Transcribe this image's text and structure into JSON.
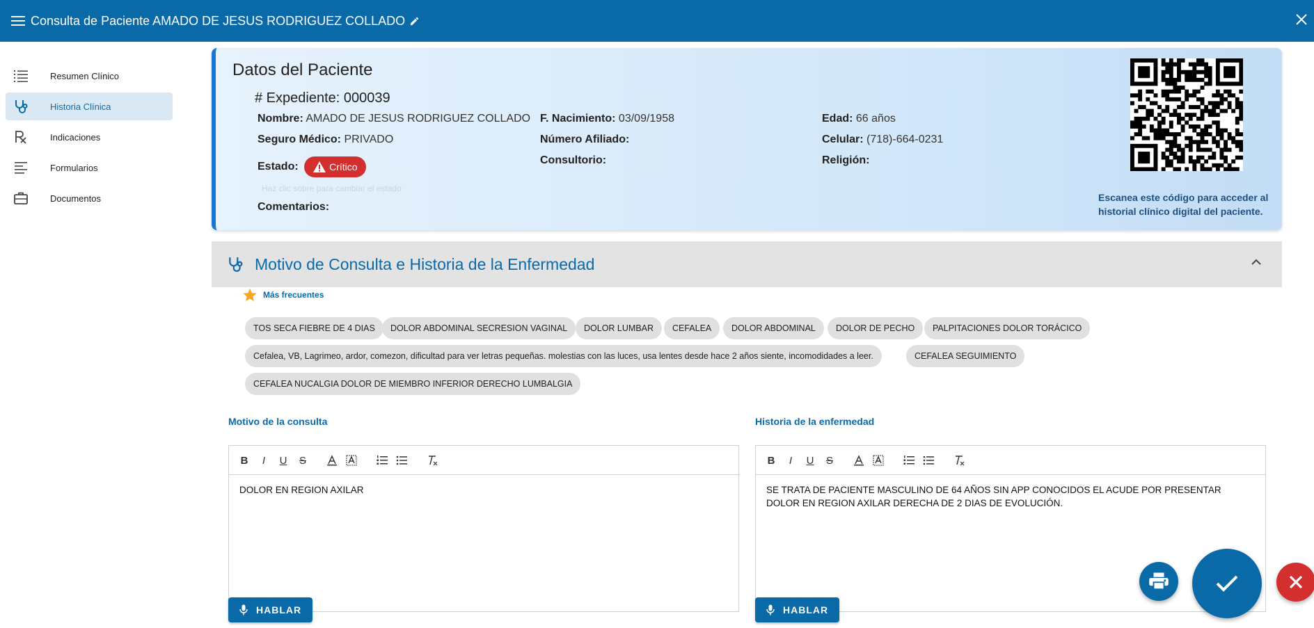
{
  "appbar": {
    "title": "Consulta de Paciente AMADO DE JESUS RODRIGUEZ COLLADO",
    "menu_icon": "menu-icon",
    "edit_icon": "pencil-icon",
    "close_icon": "close-icon",
    "color": "#0a6aa8"
  },
  "sidebar": {
    "items": [
      {
        "label": "Resumen Clínico",
        "icon": "list-icon",
        "active": false
      },
      {
        "label": "Historia Clínica",
        "icon": "stethoscope-icon",
        "active": true
      },
      {
        "label": "Indicaciones",
        "icon": "prescription-icon",
        "active": false
      },
      {
        "label": "Formularios",
        "icon": "lines-icon",
        "active": false
      },
      {
        "label": "Documentos",
        "icon": "briefcase-icon",
        "active": false
      }
    ]
  },
  "patient": {
    "card_title": "Datos del Paciente",
    "expediente": "# Expediente: 000039",
    "nombre_label": "Nombre:",
    "nombre": "AMADO DE JESUS RODRIGUEZ COLLADO",
    "nacimiento_label": "F. Nacimiento:",
    "nacimiento": "03/09/1958",
    "edad_label": "Edad:",
    "edad": "66 años",
    "seguro_label": "Seguro Médico:",
    "seguro": "PRIVADO",
    "afiliado_label": "Número Afiliado:",
    "afiliado": "",
    "celular_label": "Celular:",
    "celular": "(718)-664-0231",
    "estado_label": "Estado:",
    "estado": "Crítico",
    "estado_color": "#d32f2f",
    "consultorio_label": "Consultorio:",
    "consultorio": "",
    "religion_label": "Religión:",
    "religion": "",
    "faint_hint": "Haz clic sobre para cambiar el estado",
    "comentarios_label": "Comentarios:",
    "comentarios": "",
    "qr_caption": "Escanea este código para acceder al historial clínico digital del paciente."
  },
  "section": {
    "title": "Motivo de Consulta e Historia de la Enfermedad",
    "icon": "stethoscope-icon",
    "chevron": "chevron-up-icon",
    "frequent_label": "Más frecuentes",
    "chips": [
      "TOS SECA FIEBRE DE 4 DIAS",
      "DOLOR ABDOMINAL SECRESION VAGINAL",
      "DOLOR LUMBAR",
      "CEFALEA",
      "DOLOR ABDOMINAL",
      "DOLOR DE PECHO",
      "PALPITACIONES DOLOR TORÁCICO",
      "Cefalea, VB, Lagrimeo, ardor, comezon, dificultad para ver letras pequeñas. molestias con las luces, usa lentes desde hace 2 años siente, incomodidades a leer.",
      "CEFALEA SEGUIMIENTO",
      "CEFALEA NUCALGIA DOLOR DE MIEMBRO INFERIOR DERECHO LUMBALGIA"
    ]
  },
  "editors": {
    "motivo": {
      "label": "Motivo de la consulta",
      "content": "DOLOR EN REGION AXILAR"
    },
    "historia": {
      "label": "Historia de la enfermedad",
      "content": "SE TRATA DE PACIENTE MASCULINO DE 64 AÑOS SIN APP CONOCIDOS EL ACUDE POR PRESENTAR DOLOR EN REGION AXILAR DERECHA DE 2 DIAS DE EVOLUCIÓN."
    },
    "hablar_label": "HABLAR"
  },
  "fabs": {
    "print_icon": "printer-icon",
    "save_icon": "check-icon",
    "cancel_icon": "close-icon",
    "primary_color": "#0a6aa8",
    "danger_color": "#d32f2f"
  }
}
